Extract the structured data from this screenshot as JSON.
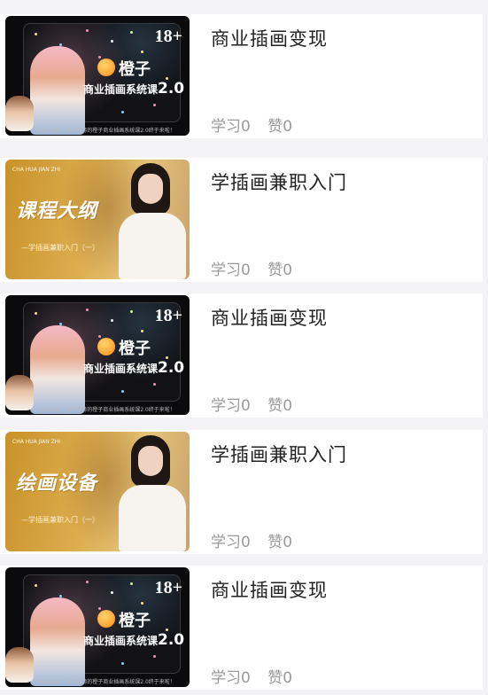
{
  "items": [
    {
      "title": "商业插画变现",
      "study": "学习0",
      "likes": "赞0",
      "thumb": {
        "style": "dark",
        "age": "18+",
        "brand": "橙子",
        "course": "商业插画系统课",
        "version": "2.0",
        "footer": "Hello Hello 万众期待的橙子商业插画系统课2.0终于来啦！"
      }
    },
    {
      "title": "学插画兼职入门",
      "study": "学习0",
      "likes": "赞0",
      "thumb": {
        "style": "gold",
        "tag": "CHA HUA JIAN ZHI",
        "headline": "课程大纲",
        "sub": "—学插画兼职入门（一）"
      }
    },
    {
      "title": "商业插画变现",
      "study": "学习0",
      "likes": "赞0",
      "thumb": {
        "style": "dark",
        "age": "18+",
        "brand": "橙子",
        "course": "商业插画系统课",
        "version": "2.0",
        "footer": "Hello Hello 万众期待的橙子商业插画系统课2.0终于来啦！"
      }
    },
    {
      "title": "学插画兼职入门",
      "study": "学习0",
      "likes": "赞0",
      "thumb": {
        "style": "gold",
        "tag": "CHA HUA JIAN ZHI",
        "headline": "绘画设备",
        "sub": "—学插画兼职入门（一）"
      }
    },
    {
      "title": "商业插画变现",
      "study": "学习0",
      "likes": "赞0",
      "thumb": {
        "style": "dark",
        "age": "18+",
        "brand": "橙子",
        "course": "商业插画系统课",
        "version": "2.0",
        "footer": "Hello Hello 万众期待的橙子商业插画系统课2.0终于来啦！"
      }
    }
  ]
}
